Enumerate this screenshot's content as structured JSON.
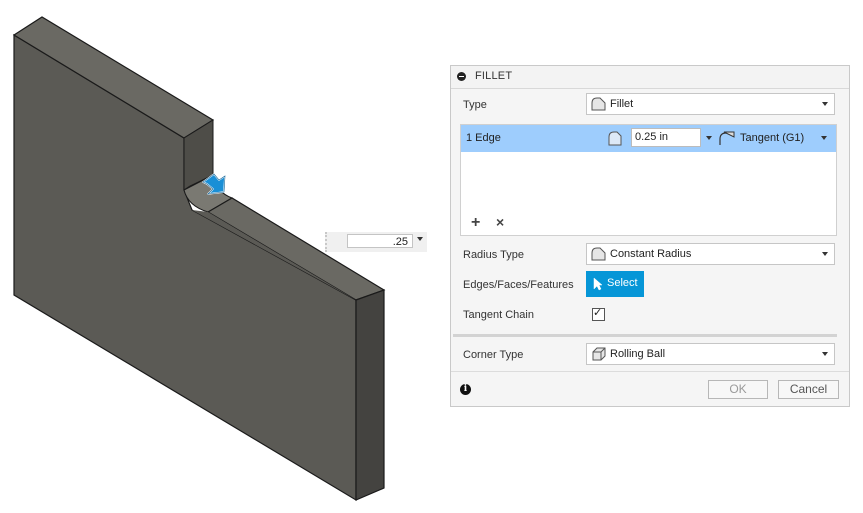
{
  "canvas": {
    "inline_radius_value": ".25",
    "colors": {
      "part_face": "#5b5a55",
      "part_top": "#6a6963",
      "part_side": "#444340",
      "edge": "#1a1a1a",
      "manipulator": "#1a8fd6"
    }
  },
  "dialog": {
    "title": "FILLET",
    "type_label": "Type",
    "type_value": "Fillet",
    "edge_set": {
      "label": "1 Edge",
      "radius": "0.25 in",
      "continuity": "Tangent (G1)"
    },
    "radius_type_label": "Radius Type",
    "radius_type_value": "Constant Radius",
    "edges_label": "Edges/Faces/Features",
    "select_label": "Select",
    "tangent_chain_label": "Tangent Chain",
    "tangent_chain_checked": true,
    "corner_type_label": "Corner Type",
    "corner_type_value": "Rolling Ball",
    "ok_label": "OK",
    "cancel_label": "Cancel",
    "icons": [
      "collapse-icon",
      "fillet-icon",
      "tangent-icon",
      "add-icon",
      "remove-icon",
      "select-arrow-icon",
      "corner-icon",
      "info-icon"
    ],
    "accent": "#0696d7",
    "selected_row": "#9ecdfd"
  }
}
